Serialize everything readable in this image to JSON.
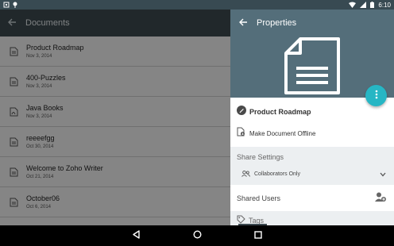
{
  "status_bar": {
    "time": "6:10",
    "icons": [
      "notification-icon",
      "location-icon",
      "wifi-icon",
      "signal-icon",
      "battery-icon"
    ]
  },
  "left_pane": {
    "title": "Documents",
    "documents": [
      {
        "name": "Product Roadmap",
        "date": "Nov 3, 2014",
        "icon": "doc-icon"
      },
      {
        "name": "400-Puzzles",
        "date": "Nov 3, 2014",
        "icon": "doc-icon"
      },
      {
        "name": "Java Books",
        "date": "Nov 3, 2014",
        "icon": "pdf-icon"
      },
      {
        "name": "reeeefgg",
        "date": "Oct 30, 2014",
        "icon": "doc-icon"
      },
      {
        "name": "Welcome to Zoho Writer",
        "date": "Oct 21, 2014",
        "icon": "doc-icon"
      },
      {
        "name": "October06",
        "date": "Oct 6, 2014",
        "icon": "doc-icon"
      }
    ]
  },
  "right_pane": {
    "title": "Properties",
    "document_name": "Product Roadmap",
    "offline_label": "Make Document Offline",
    "share_settings": {
      "title": "Share Settings",
      "selected": "Collaborators Only"
    },
    "shared_users_label": "Shared Users",
    "tags_label": "Tags"
  },
  "colors": {
    "header": "#546e7a",
    "toolbar": "#3d4a51",
    "fab": "#26b6c4"
  }
}
